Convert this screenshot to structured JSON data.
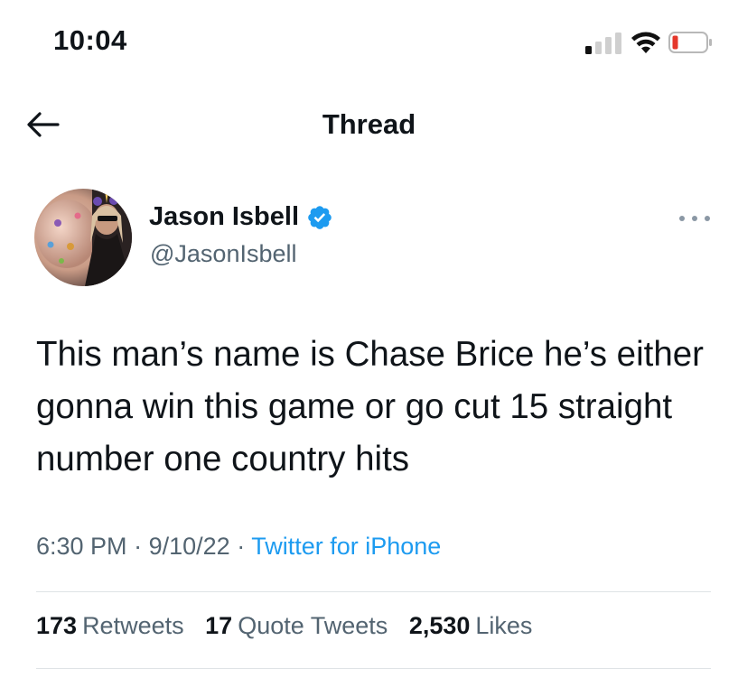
{
  "status_bar": {
    "time": "10:04",
    "signal_bars_active": 1,
    "signal_bars_total": 4,
    "battery_level": 0.15,
    "battery_color": "#e5372b"
  },
  "header": {
    "title": "Thread",
    "back_icon": "arrow-left-icon"
  },
  "tweet": {
    "author": {
      "display_name": "Jason Isbell",
      "handle": "@JasonIsbell",
      "verified": true,
      "verified_color": "#1d9bf0"
    },
    "text": "This man’s name is Chase Brice he’s either gonna win this game or go cut 15 straight number one country hits",
    "time": "6:30 PM",
    "sep1": "·",
    "date": "9/10/22",
    "sep2": "·",
    "source": "Twitter for iPhone",
    "stats": {
      "retweets_count": "173",
      "retweets_label": "Retweets",
      "quotes_count": "17",
      "quotes_label": "Quote Tweets",
      "likes_count": "2,530",
      "likes_label": "Likes"
    }
  },
  "colors": {
    "text_primary": "#0f1419",
    "text_secondary": "#536471",
    "link": "#1d9bf0",
    "divider": "#dfe3e6"
  }
}
